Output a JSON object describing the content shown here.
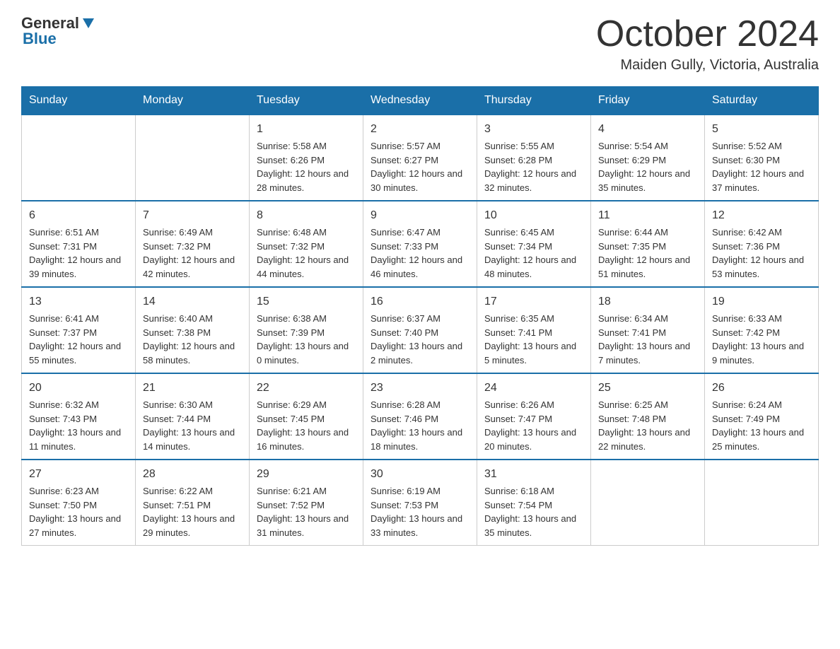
{
  "header": {
    "logo": {
      "general": "General",
      "blue": "Blue"
    },
    "month": "October 2024",
    "location": "Maiden Gully, Victoria, Australia"
  },
  "weekdays": [
    "Sunday",
    "Monday",
    "Tuesday",
    "Wednesday",
    "Thursday",
    "Friday",
    "Saturday"
  ],
  "weeks": [
    [
      {
        "day": "",
        "sunrise": "",
        "sunset": "",
        "daylight": ""
      },
      {
        "day": "",
        "sunrise": "",
        "sunset": "",
        "daylight": ""
      },
      {
        "day": "1",
        "sunrise": "Sunrise: 5:58 AM",
        "sunset": "Sunset: 6:26 PM",
        "daylight": "Daylight: 12 hours and 28 minutes."
      },
      {
        "day": "2",
        "sunrise": "Sunrise: 5:57 AM",
        "sunset": "Sunset: 6:27 PM",
        "daylight": "Daylight: 12 hours and 30 minutes."
      },
      {
        "day": "3",
        "sunrise": "Sunrise: 5:55 AM",
        "sunset": "Sunset: 6:28 PM",
        "daylight": "Daylight: 12 hours and 32 minutes."
      },
      {
        "day": "4",
        "sunrise": "Sunrise: 5:54 AM",
        "sunset": "Sunset: 6:29 PM",
        "daylight": "Daylight: 12 hours and 35 minutes."
      },
      {
        "day": "5",
        "sunrise": "Sunrise: 5:52 AM",
        "sunset": "Sunset: 6:30 PM",
        "daylight": "Daylight: 12 hours and 37 minutes."
      }
    ],
    [
      {
        "day": "6",
        "sunrise": "Sunrise: 6:51 AM",
        "sunset": "Sunset: 7:31 PM",
        "daylight": "Daylight: 12 hours and 39 minutes."
      },
      {
        "day": "7",
        "sunrise": "Sunrise: 6:49 AM",
        "sunset": "Sunset: 7:32 PM",
        "daylight": "Daylight: 12 hours and 42 minutes."
      },
      {
        "day": "8",
        "sunrise": "Sunrise: 6:48 AM",
        "sunset": "Sunset: 7:32 PM",
        "daylight": "Daylight: 12 hours and 44 minutes."
      },
      {
        "day": "9",
        "sunrise": "Sunrise: 6:47 AM",
        "sunset": "Sunset: 7:33 PM",
        "daylight": "Daylight: 12 hours and 46 minutes."
      },
      {
        "day": "10",
        "sunrise": "Sunrise: 6:45 AM",
        "sunset": "Sunset: 7:34 PM",
        "daylight": "Daylight: 12 hours and 48 minutes."
      },
      {
        "day": "11",
        "sunrise": "Sunrise: 6:44 AM",
        "sunset": "Sunset: 7:35 PM",
        "daylight": "Daylight: 12 hours and 51 minutes."
      },
      {
        "day": "12",
        "sunrise": "Sunrise: 6:42 AM",
        "sunset": "Sunset: 7:36 PM",
        "daylight": "Daylight: 12 hours and 53 minutes."
      }
    ],
    [
      {
        "day": "13",
        "sunrise": "Sunrise: 6:41 AM",
        "sunset": "Sunset: 7:37 PM",
        "daylight": "Daylight: 12 hours and 55 minutes."
      },
      {
        "day": "14",
        "sunrise": "Sunrise: 6:40 AM",
        "sunset": "Sunset: 7:38 PM",
        "daylight": "Daylight: 12 hours and 58 minutes."
      },
      {
        "day": "15",
        "sunrise": "Sunrise: 6:38 AM",
        "sunset": "Sunset: 7:39 PM",
        "daylight": "Daylight: 13 hours and 0 minutes."
      },
      {
        "day": "16",
        "sunrise": "Sunrise: 6:37 AM",
        "sunset": "Sunset: 7:40 PM",
        "daylight": "Daylight: 13 hours and 2 minutes."
      },
      {
        "day": "17",
        "sunrise": "Sunrise: 6:35 AM",
        "sunset": "Sunset: 7:41 PM",
        "daylight": "Daylight: 13 hours and 5 minutes."
      },
      {
        "day": "18",
        "sunrise": "Sunrise: 6:34 AM",
        "sunset": "Sunset: 7:41 PM",
        "daylight": "Daylight: 13 hours and 7 minutes."
      },
      {
        "day": "19",
        "sunrise": "Sunrise: 6:33 AM",
        "sunset": "Sunset: 7:42 PM",
        "daylight": "Daylight: 13 hours and 9 minutes."
      }
    ],
    [
      {
        "day": "20",
        "sunrise": "Sunrise: 6:32 AM",
        "sunset": "Sunset: 7:43 PM",
        "daylight": "Daylight: 13 hours and 11 minutes."
      },
      {
        "day": "21",
        "sunrise": "Sunrise: 6:30 AM",
        "sunset": "Sunset: 7:44 PM",
        "daylight": "Daylight: 13 hours and 14 minutes."
      },
      {
        "day": "22",
        "sunrise": "Sunrise: 6:29 AM",
        "sunset": "Sunset: 7:45 PM",
        "daylight": "Daylight: 13 hours and 16 minutes."
      },
      {
        "day": "23",
        "sunrise": "Sunrise: 6:28 AM",
        "sunset": "Sunset: 7:46 PM",
        "daylight": "Daylight: 13 hours and 18 minutes."
      },
      {
        "day": "24",
        "sunrise": "Sunrise: 6:26 AM",
        "sunset": "Sunset: 7:47 PM",
        "daylight": "Daylight: 13 hours and 20 minutes."
      },
      {
        "day": "25",
        "sunrise": "Sunrise: 6:25 AM",
        "sunset": "Sunset: 7:48 PM",
        "daylight": "Daylight: 13 hours and 22 minutes."
      },
      {
        "day": "26",
        "sunrise": "Sunrise: 6:24 AM",
        "sunset": "Sunset: 7:49 PM",
        "daylight": "Daylight: 13 hours and 25 minutes."
      }
    ],
    [
      {
        "day": "27",
        "sunrise": "Sunrise: 6:23 AM",
        "sunset": "Sunset: 7:50 PM",
        "daylight": "Daylight: 13 hours and 27 minutes."
      },
      {
        "day": "28",
        "sunrise": "Sunrise: 6:22 AM",
        "sunset": "Sunset: 7:51 PM",
        "daylight": "Daylight: 13 hours and 29 minutes."
      },
      {
        "day": "29",
        "sunrise": "Sunrise: 6:21 AM",
        "sunset": "Sunset: 7:52 PM",
        "daylight": "Daylight: 13 hours and 31 minutes."
      },
      {
        "day": "30",
        "sunrise": "Sunrise: 6:19 AM",
        "sunset": "Sunset: 7:53 PM",
        "daylight": "Daylight: 13 hours and 33 minutes."
      },
      {
        "day": "31",
        "sunrise": "Sunrise: 6:18 AM",
        "sunset": "Sunset: 7:54 PM",
        "daylight": "Daylight: 13 hours and 35 minutes."
      },
      {
        "day": "",
        "sunrise": "",
        "sunset": "",
        "daylight": ""
      },
      {
        "day": "",
        "sunrise": "",
        "sunset": "",
        "daylight": ""
      }
    ]
  ]
}
